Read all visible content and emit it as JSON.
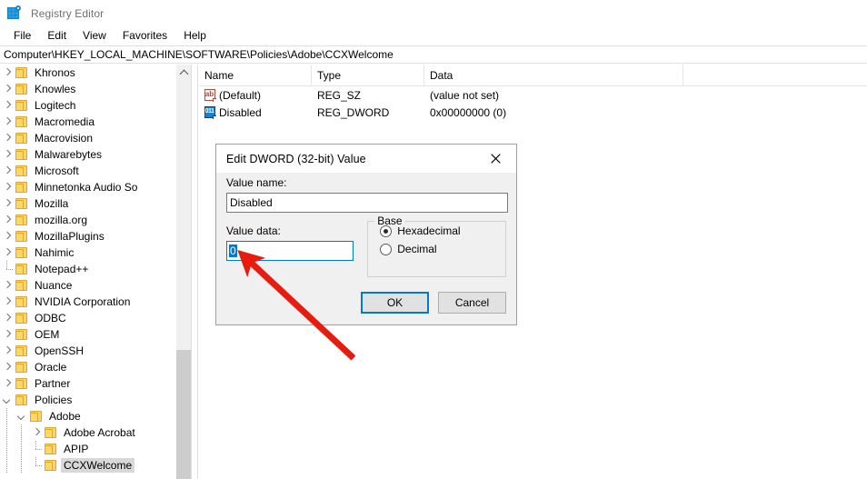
{
  "window": {
    "title": "Registry Editor",
    "icon": "registry-editor-icon"
  },
  "menubar": {
    "items": [
      {
        "label": "File"
      },
      {
        "label": "Edit"
      },
      {
        "label": "View"
      },
      {
        "label": "Favorites"
      },
      {
        "label": "Help"
      }
    ]
  },
  "address": {
    "path": "Computer\\HKEY_LOCAL_MACHINE\\SOFTWARE\\Policies\\Adobe\\CCXWelcome"
  },
  "tree": {
    "items": [
      {
        "label": "Khronos",
        "indent": 1,
        "toggle": "collapsed",
        "selected": false
      },
      {
        "label": "Knowles",
        "indent": 1,
        "toggle": "collapsed",
        "selected": false
      },
      {
        "label": "Logitech",
        "indent": 1,
        "toggle": "collapsed",
        "selected": false
      },
      {
        "label": "Macromedia",
        "indent": 1,
        "toggle": "collapsed",
        "selected": false
      },
      {
        "label": "Macrovision",
        "indent": 1,
        "toggle": "collapsed",
        "selected": false
      },
      {
        "label": "Malwarebytes",
        "indent": 1,
        "toggle": "collapsed",
        "selected": false
      },
      {
        "label": "Microsoft",
        "indent": 1,
        "toggle": "collapsed",
        "selected": false
      },
      {
        "label": "Minnetonka Audio So",
        "indent": 1,
        "toggle": "collapsed",
        "selected": false
      },
      {
        "label": "Mozilla",
        "indent": 1,
        "toggle": "collapsed",
        "selected": false
      },
      {
        "label": "mozilla.org",
        "indent": 1,
        "toggle": "collapsed",
        "selected": false
      },
      {
        "label": "MozillaPlugins",
        "indent": 1,
        "toggle": "collapsed",
        "selected": false
      },
      {
        "label": "Nahimic",
        "indent": 1,
        "toggle": "collapsed",
        "selected": false
      },
      {
        "label": "Notepad++",
        "indent": 1,
        "toggle": "none",
        "selected": false
      },
      {
        "label": "Nuance",
        "indent": 1,
        "toggle": "collapsed",
        "selected": false
      },
      {
        "label": "NVIDIA Corporation",
        "indent": 1,
        "toggle": "collapsed",
        "selected": false
      },
      {
        "label": "ODBC",
        "indent": 1,
        "toggle": "collapsed",
        "selected": false
      },
      {
        "label": "OEM",
        "indent": 1,
        "toggle": "collapsed",
        "selected": false
      },
      {
        "label": "OpenSSH",
        "indent": 1,
        "toggle": "collapsed",
        "selected": false
      },
      {
        "label": "Oracle",
        "indent": 1,
        "toggle": "collapsed",
        "selected": false
      },
      {
        "label": "Partner",
        "indent": 1,
        "toggle": "collapsed",
        "selected": false
      },
      {
        "label": "Policies",
        "indent": 1,
        "toggle": "expanded",
        "selected": false
      },
      {
        "label": "Adobe",
        "indent": 2,
        "toggle": "expanded",
        "selected": false
      },
      {
        "label": "Adobe Acrobat",
        "indent": 3,
        "toggle": "collapsed",
        "selected": false
      },
      {
        "label": "APIP",
        "indent": 3,
        "toggle": "none",
        "selected": false
      },
      {
        "label": "CCXWelcome",
        "indent": 3,
        "toggle": "none",
        "selected": true
      }
    ]
  },
  "list": {
    "columns": [
      "Name",
      "Type",
      "Data"
    ],
    "rows": [
      {
        "name": "(Default)",
        "type": "REG_SZ",
        "data": "(value not set)",
        "icon": "string-value-icon",
        "glyph": "ab"
      },
      {
        "name": "Disabled",
        "type": "REG_DWORD",
        "data": "0x00000000 (0)",
        "icon": "dword-value-icon",
        "glyph": "011"
      }
    ]
  },
  "dialog": {
    "title": "Edit DWORD (32-bit) Value",
    "close_label": "✕",
    "value_name_label": "Value name:",
    "value_name": "Disabled",
    "value_data_label": "Value data:",
    "value_data": "0",
    "base": {
      "legend": "Base",
      "options": [
        {
          "label": "Hexadecimal",
          "checked": true
        },
        {
          "label": "Decimal",
          "checked": false
        }
      ]
    },
    "buttons": {
      "ok": "OK",
      "cancel": "Cancel"
    }
  },
  "annotation": {
    "arrow_color": "#e81c0e"
  }
}
